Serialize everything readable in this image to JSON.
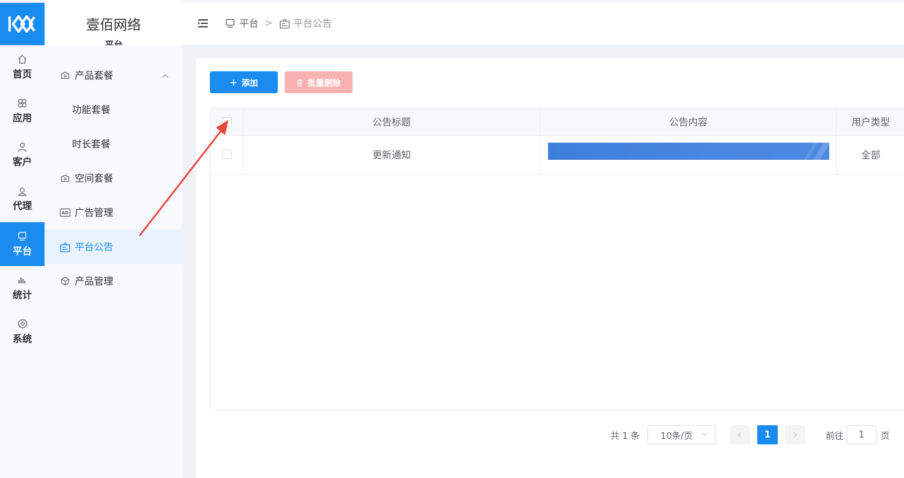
{
  "brand": {
    "title": "壹佰网络",
    "subtitle": "平台"
  },
  "rail": {
    "items": [
      {
        "label": "首页",
        "icon": "home-icon"
      },
      {
        "label": "应用",
        "icon": "apps-icon"
      },
      {
        "label": "客户",
        "icon": "user-icon"
      },
      {
        "label": "代理",
        "icon": "agent-icon"
      },
      {
        "label": "平台",
        "icon": "monitor-icon"
      },
      {
        "label": "统计",
        "icon": "bar-chart-icon"
      },
      {
        "label": "系统",
        "icon": "gear-icon"
      }
    ],
    "active": "平台"
  },
  "menu": {
    "items": [
      {
        "label": "产品套餐",
        "icon": "camera-box-icon"
      },
      {
        "label": "功能套餐"
      },
      {
        "label": "时长套餐"
      },
      {
        "label": "空间套餐",
        "icon": "camera-box-icon"
      },
      {
        "label": "广告管理",
        "icon": "ad-icon"
      },
      {
        "label": "平台公告",
        "icon": "notice-board-icon"
      },
      {
        "label": "产品管理",
        "icon": "cube-icon"
      }
    ],
    "active": "平台公告"
  },
  "breadcrumb": {
    "root": "平台",
    "separator": ">",
    "current": "平台公告"
  },
  "toolbar": {
    "add_label": "添加",
    "batch_delete_label": "批量删除"
  },
  "table": {
    "columns": [
      "公告标题",
      "公告内容",
      "用户类型"
    ],
    "rows": [
      {
        "title": "更新通知",
        "type": "全部"
      }
    ]
  },
  "pagination": {
    "total": "共 1 条",
    "page_size": "10条/页",
    "current_page": "1",
    "goto_label": "前往",
    "goto_value": "1",
    "page_suffix": "页"
  },
  "colors": {
    "primary": "#1a8cf0",
    "danger_disabled": "#fab1b1",
    "annotation_arrow": "#e8453c"
  }
}
